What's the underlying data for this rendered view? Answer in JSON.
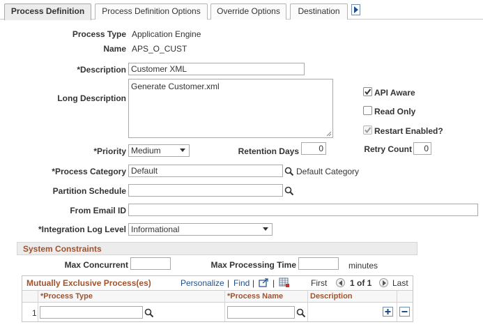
{
  "tabs": [
    {
      "label": "Process Definition",
      "active": true
    },
    {
      "label": "Process Definition Options",
      "active": false
    },
    {
      "label": "Override Options",
      "active": false
    },
    {
      "label": "Destination",
      "active": false
    }
  ],
  "form": {
    "process_type_label": "Process Type",
    "process_type_value": "Application Engine",
    "name_label": "Name",
    "name_value": "APS_O_CUST",
    "description_label": "*Description",
    "description_value": "Customer XML",
    "long_description_label": "Long Description",
    "long_description_value": "Generate Customer.xml",
    "priority_label": "*Priority",
    "priority_value": "Medium",
    "retention_days_label": "Retention Days",
    "retention_days_value": "0",
    "retry_count_label": "Retry Count",
    "retry_count_value": "0",
    "process_category_label": "*Process Category",
    "process_category_value": "Default",
    "process_category_desc": "Default Category",
    "partition_schedule_label": "Partition Schedule",
    "partition_schedule_value": "",
    "from_email_label": "From Email ID",
    "from_email_value": "",
    "integration_log_label": "*Integration Log Level",
    "integration_log_value": "Informational"
  },
  "checkboxes": {
    "api_aware": {
      "label": "API Aware",
      "checked": true
    },
    "read_only": {
      "label": "Read Only",
      "checked": false
    },
    "restart_enabled": {
      "label": "Restart Enabled?",
      "checked": true,
      "disabled": true
    }
  },
  "system_constraints": {
    "title": "System Constraints",
    "max_concurrent_label": "Max Concurrent",
    "max_concurrent_value": "",
    "max_processing_label": "Max Processing Time",
    "max_processing_value": "",
    "minutes_label": "minutes"
  },
  "grid": {
    "title": "Mutually Exclusive Process(es)",
    "personalize": "Personalize",
    "separator": "|",
    "find": "Find",
    "first": "First",
    "page_info": "1 of 1",
    "last": "Last",
    "columns": [
      "*Process Type",
      "*Process Name",
      "Description"
    ],
    "rows": [
      {
        "num": "1",
        "process_type": "",
        "process_name": "",
        "description": ""
      }
    ]
  },
  "icons": {
    "lookup": "magnifier-icon",
    "tab_next": "chevron-right-icon",
    "add_row": "plus-icon",
    "delete_row": "minus-icon"
  },
  "colors": {
    "section_title": "#a0522d",
    "link": "#1f4e8c"
  }
}
